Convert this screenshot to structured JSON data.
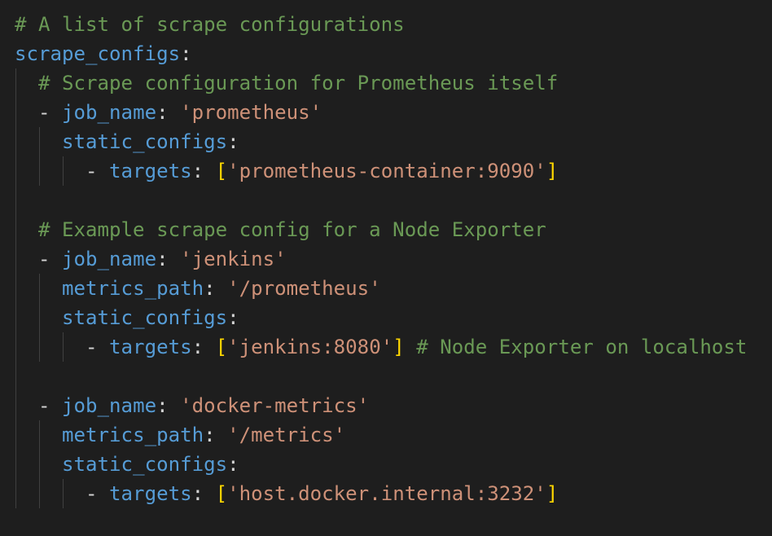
{
  "editor": {
    "lines": [
      {
        "tokens": [
          {
            "t": "# A list of scrape configurations",
            "c": "comment"
          }
        ]
      },
      {
        "tokens": [
          {
            "t": "scrape_configs",
            "c": "key"
          },
          {
            "t": ":",
            "c": "punct"
          }
        ]
      },
      {
        "tokens": [
          {
            "t": "  ",
            "c": "punct"
          },
          {
            "t": "# Scrape configuration for Prometheus itself",
            "c": "comment"
          }
        ]
      },
      {
        "tokens": [
          {
            "t": "  - ",
            "c": "punct"
          },
          {
            "t": "job_name",
            "c": "key"
          },
          {
            "t": ": ",
            "c": "punct"
          },
          {
            "t": "'prometheus'",
            "c": "str"
          }
        ]
      },
      {
        "tokens": [
          {
            "t": "    ",
            "c": "punct"
          },
          {
            "t": "static_configs",
            "c": "key"
          },
          {
            "t": ":",
            "c": "punct"
          }
        ]
      },
      {
        "tokens": [
          {
            "t": "      - ",
            "c": "punct"
          },
          {
            "t": "targets",
            "c": "key"
          },
          {
            "t": ": ",
            "c": "punct"
          },
          {
            "t": "[",
            "c": "bracket"
          },
          {
            "t": "'prometheus-container:9090'",
            "c": "str"
          },
          {
            "t": "]",
            "c": "bracket"
          }
        ]
      },
      {
        "tokens": []
      },
      {
        "tokens": [
          {
            "t": "  ",
            "c": "punct"
          },
          {
            "t": "# Example scrape config for a Node Exporter",
            "c": "comment"
          }
        ]
      },
      {
        "tokens": [
          {
            "t": "  - ",
            "c": "punct"
          },
          {
            "t": "job_name",
            "c": "key"
          },
          {
            "t": ": ",
            "c": "punct"
          },
          {
            "t": "'jenkins'",
            "c": "str"
          }
        ]
      },
      {
        "tokens": [
          {
            "t": "    ",
            "c": "punct"
          },
          {
            "t": "metrics_path",
            "c": "key"
          },
          {
            "t": ": ",
            "c": "punct"
          },
          {
            "t": "'/prometheus'",
            "c": "str"
          }
        ]
      },
      {
        "tokens": [
          {
            "t": "    ",
            "c": "punct"
          },
          {
            "t": "static_configs",
            "c": "key"
          },
          {
            "t": ":",
            "c": "punct"
          }
        ]
      },
      {
        "tokens": [
          {
            "t": "      - ",
            "c": "punct"
          },
          {
            "t": "targets",
            "c": "key"
          },
          {
            "t": ": ",
            "c": "punct"
          },
          {
            "t": "[",
            "c": "bracket"
          },
          {
            "t": "'jenkins:8080'",
            "c": "str"
          },
          {
            "t": "]",
            "c": "bracket"
          },
          {
            "t": " ",
            "c": "punct"
          },
          {
            "t": "# Node Exporter on localhost",
            "c": "comment"
          }
        ]
      },
      {
        "tokens": []
      },
      {
        "tokens": [
          {
            "t": "  - ",
            "c": "punct"
          },
          {
            "t": "job_name",
            "c": "key"
          },
          {
            "t": ": ",
            "c": "punct"
          },
          {
            "t": "'docker-metrics'",
            "c": "str"
          }
        ]
      },
      {
        "tokens": [
          {
            "t": "    ",
            "c": "punct"
          },
          {
            "t": "metrics_path",
            "c": "key"
          },
          {
            "t": ": ",
            "c": "punct"
          },
          {
            "t": "'/metrics'",
            "c": "str"
          }
        ]
      },
      {
        "tokens": [
          {
            "t": "    ",
            "c": "punct"
          },
          {
            "t": "static_configs",
            "c": "key"
          },
          {
            "t": ":",
            "c": "punct"
          }
        ]
      },
      {
        "tokens": [
          {
            "t": "      - ",
            "c": "punct"
          },
          {
            "t": "targets",
            "c": "key"
          },
          {
            "t": ": ",
            "c": "punct"
          },
          {
            "t": "[",
            "c": "bracket"
          },
          {
            "t": "'host.docker.internal:3232'",
            "c": "str"
          },
          {
            "t": "]",
            "c": "bracket"
          }
        ]
      }
    ]
  },
  "colors": {
    "background": "#1e1e1e",
    "comment": "#6a9955",
    "key": "#569cd6",
    "string": "#ce9178",
    "bracket": "#ffd700",
    "punctuation": "#d4d4d4",
    "indent_guide": "#404040"
  }
}
